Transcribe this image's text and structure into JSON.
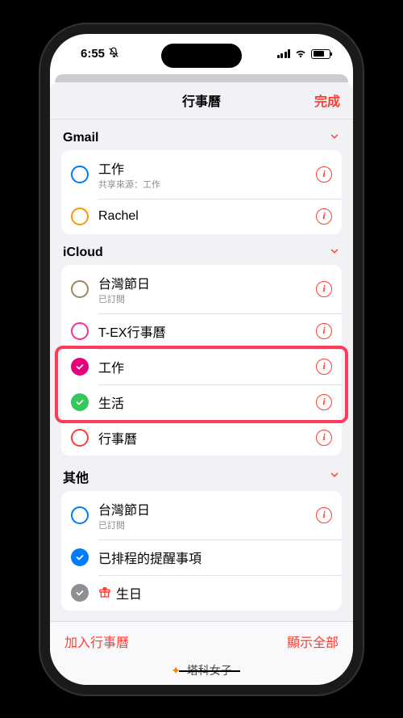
{
  "status": {
    "time": "6:55",
    "wifi": "wifi-icon"
  },
  "sheet": {
    "title": "行事曆",
    "done": "完成"
  },
  "sections": [
    {
      "header": "Gmail",
      "items": [
        {
          "title": "工作",
          "sub": "共享來源：工作",
          "color": "#007aff",
          "checked": false,
          "hasInfo": true
        },
        {
          "title": "Rachel",
          "sub": "",
          "color": "#ff9500",
          "checked": false,
          "hasInfo": true
        }
      ]
    },
    {
      "header": "iCloud",
      "items": [
        {
          "title": "台灣節日",
          "sub": "已訂閱",
          "color": "#a2845e",
          "checked": false,
          "hasInfo": true
        },
        {
          "title": "T-EX行事曆",
          "sub": "",
          "color": "#ff2d92",
          "checked": false,
          "hasInfo": true
        },
        {
          "title": "工作",
          "sub": "",
          "color": "#e6007a",
          "checked": true,
          "hasInfo": true
        },
        {
          "title": "生活",
          "sub": "",
          "color": "#34c759",
          "checked": true,
          "hasInfo": true
        },
        {
          "title": "行事曆",
          "sub": "",
          "color": "#ff3b30",
          "checked": false,
          "hasInfo": true
        }
      ]
    },
    {
      "header": "其他",
      "items": [
        {
          "title": "台灣節日",
          "sub": "已訂閱",
          "color": "#007aff",
          "checked": false,
          "hasInfo": true
        },
        {
          "title": "已排程的提醒事項",
          "sub": "",
          "color": "#007aff",
          "checked": true,
          "hasInfo": false
        },
        {
          "title": "生日",
          "sub": "",
          "color": "#8e8e93",
          "checked": true,
          "hasInfo": false,
          "icon": "gift"
        }
      ]
    }
  ],
  "footer": {
    "add": "加入行事曆",
    "showAll": "顯示全部"
  },
  "watermark": "塔科女子"
}
